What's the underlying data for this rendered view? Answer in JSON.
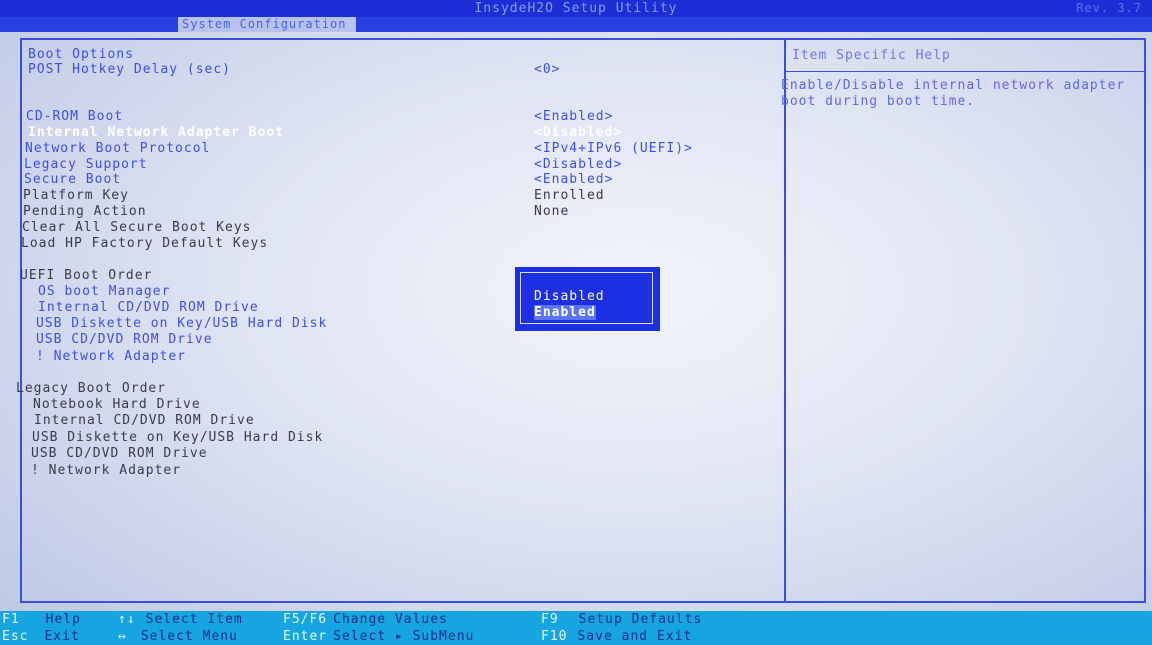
{
  "app": {
    "title": "InsydeH2O Setup Utility",
    "corner": "Rev. 3.7",
    "active_tab": "System Configuration"
  },
  "settings": {
    "boot_options_heading": "Boot Options",
    "post_hotkey_delay": {
      "label": "POST Hotkey Delay (sec)",
      "value": "<0>"
    },
    "cdrom_boot": {
      "label": "CD-ROM Boot",
      "value": "<Enabled>"
    },
    "internal_network_adapter_boot": {
      "label": "Internal Network Adapter Boot",
      "value": "<Disabled>"
    },
    "network_boot_protocol": {
      "label": "Network Boot Protocol",
      "value": "<IPv4+IPv6 (UEFI)>"
    },
    "legacy_support": {
      "label": "Legacy Support",
      "value": "<Disabled>"
    },
    "secure_boot": {
      "label": "Secure Boot",
      "value": "<Enabled>"
    },
    "platform_key": {
      "label": "Platform Key",
      "value": "Enrolled"
    },
    "pending_action": {
      "label": "Pending Action",
      "value": "None"
    },
    "clear_all_secure_boot_keys": {
      "label": "Clear All Secure Boot Keys"
    },
    "load_hp_factory_default_keys": {
      "label": "Load HP Factory Default Keys"
    }
  },
  "uefi_boot_order": {
    "heading": "UEFI Boot Order",
    "items": [
      "OS boot Manager",
      "Internal CD/DVD ROM Drive",
      "USB Diskette on Key/USB Hard Disk",
      "USB CD/DVD ROM Drive",
      "! Network Adapter"
    ]
  },
  "legacy_boot_order": {
    "heading": "Legacy Boot Order",
    "items": [
      "Notebook Hard Drive",
      "Internal CD/DVD ROM Drive",
      "USB Diskette on Key/USB Hard Disk",
      "USB CD/DVD ROM Drive",
      "! Network Adapter"
    ]
  },
  "help": {
    "title": "Item Specific Help",
    "text": "Enable/Disable internal network adapter boot during boot time."
  },
  "popup": {
    "options": [
      "Disabled",
      "Enabled"
    ],
    "selected": "Enabled"
  },
  "footer": {
    "f1": {
      "key": "F1",
      "desc": "Help"
    },
    "select_item": {
      "key": "↑↓",
      "desc": "Select Item"
    },
    "f5f6": {
      "key": "F5/F6",
      "desc": "Change Values"
    },
    "f9": {
      "key": "F9",
      "desc": "Setup Defaults"
    },
    "esc": {
      "key": "Esc",
      "desc": "Exit"
    },
    "select_menu": {
      "key": "↔",
      "desc": "Select Menu"
    },
    "enter": {
      "key": "Enter",
      "desc": "Select ▸ SubMenu"
    },
    "f10": {
      "key": "F10",
      "desc": "Save and Exit"
    }
  },
  "colors": {
    "title_bar": "#1c2fd6",
    "accent_blue": "#3d4fe8",
    "popup_bg": "#1d2fe3",
    "footer_bg": "#16a5e0"
  }
}
